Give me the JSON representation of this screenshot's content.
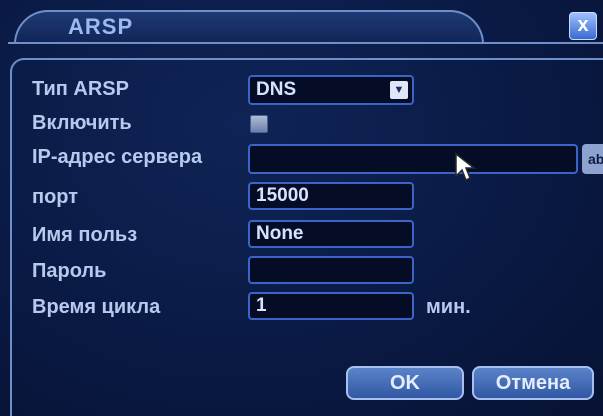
{
  "window": {
    "title": "ARSP",
    "close_label": "x"
  },
  "form": {
    "arsp_type": {
      "label": "Тип ARSP",
      "value": "DNS"
    },
    "enable": {
      "label": "Включить",
      "checked": true
    },
    "server_ip": {
      "label": "IP-адрес сервера",
      "value": "",
      "button_label": "ab"
    },
    "port": {
      "label": "порт",
      "value": "15000"
    },
    "username": {
      "label": "Имя польз",
      "value": "None"
    },
    "password": {
      "label": "Пароль",
      "value": ""
    },
    "cycle_time": {
      "label": "Время цикла",
      "value": "1",
      "unit": "мин."
    }
  },
  "buttons": {
    "ok": "OK",
    "cancel": "Отмена"
  }
}
